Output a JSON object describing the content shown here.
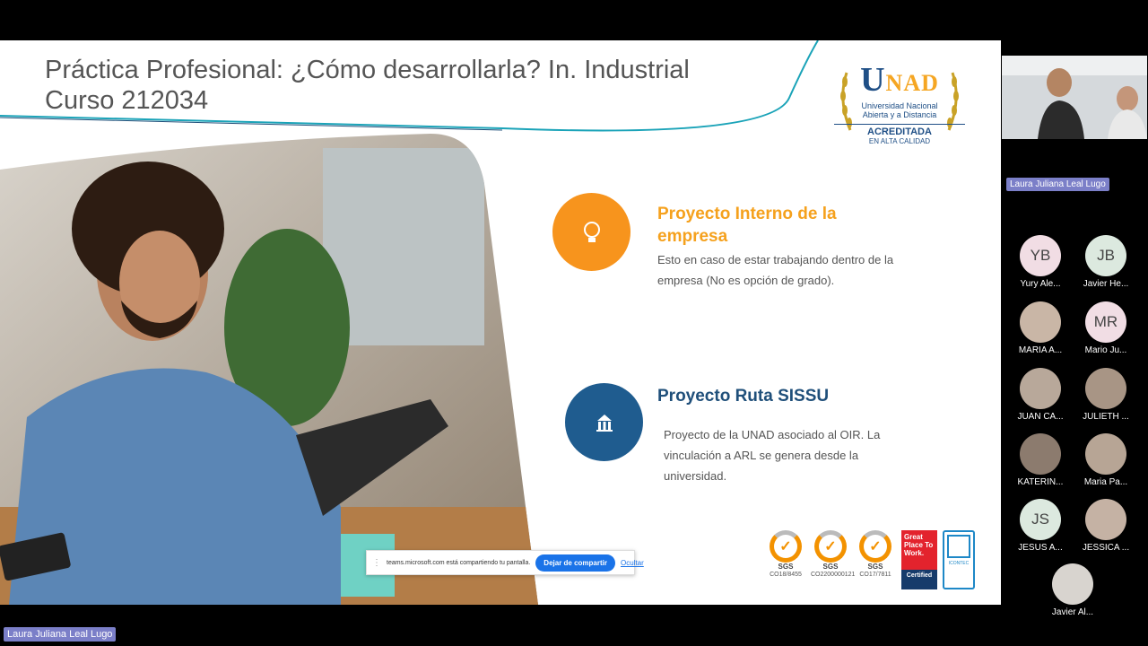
{
  "slide": {
    "title_line1": "Práctica Profesional: ¿Cómo desarrollarla? In. Industrial",
    "title_line2": "Curso 212034",
    "logo": {
      "name_u": "U",
      "name_nad": "NAD",
      "sub1": "Universidad Nacional",
      "sub2": "Abierta y a Distancia",
      "accreditation": "ACREDITADA",
      "quality": "EN ALTA CALIDAD"
    },
    "items": [
      {
        "icon": "lightbulb-icon",
        "title": "Proyecto Interno de la empresa",
        "description": "Esto en caso de estar trabajando dentro de la empresa (No es opción de grado)."
      },
      {
        "icon": "building-icon",
        "title": "Proyecto Ruta SISSU",
        "description": "Proyecto de la UNAD asociado al OIR. La vinculación a ARL se genera desde la universidad."
      }
    ],
    "badges": [
      {
        "label": "SGS",
        "code": "CO18/8455"
      },
      {
        "label": "SGS",
        "code": "CO2200000121"
      },
      {
        "label": "SGS",
        "code": "CO17/7811"
      }
    ],
    "gptw": {
      "text": "Great Place To Work.",
      "certified": "Certified"
    }
  },
  "sharebar": {
    "message": "teams.microsoft.com está compartiendo tu pantalla.",
    "stop_label": "Dejar de compartir",
    "hide_label": "Ocultar"
  },
  "presenter_label": "Laura Juliana Leal Lugo",
  "video": {
    "label": "Laura Juliana Leal Lugo"
  },
  "participants": [
    {
      "initials": "YB",
      "name": "Yury Ale...",
      "color": "#f1dde4"
    },
    {
      "initials": "JB",
      "name": "Javier He...",
      "color": "#dce9df"
    },
    {
      "initials": "",
      "name": "MARIA A...",
      "color": "#c9b6a6"
    },
    {
      "initials": "MR",
      "name": "Mario Ju...",
      "color": "#f1dde4"
    },
    {
      "initials": "",
      "name": "JUAN CA...",
      "color": "#b8a89a"
    },
    {
      "initials": "",
      "name": "JULIETH ...",
      "color": "#a89585"
    },
    {
      "initials": "",
      "name": "KATERIN...",
      "color": "#8c7b6e"
    },
    {
      "initials": "",
      "name": "Maria Pa...",
      "color": "#b7a595"
    },
    {
      "initials": "JS",
      "name": "JESUS A...",
      "color": "#dce9df"
    },
    {
      "initials": "",
      "name": "JESSICA ...",
      "color": "#c5b2a4"
    },
    {
      "initials": "",
      "name": "Javier Al...",
      "color": "#d8d4cf"
    }
  ]
}
